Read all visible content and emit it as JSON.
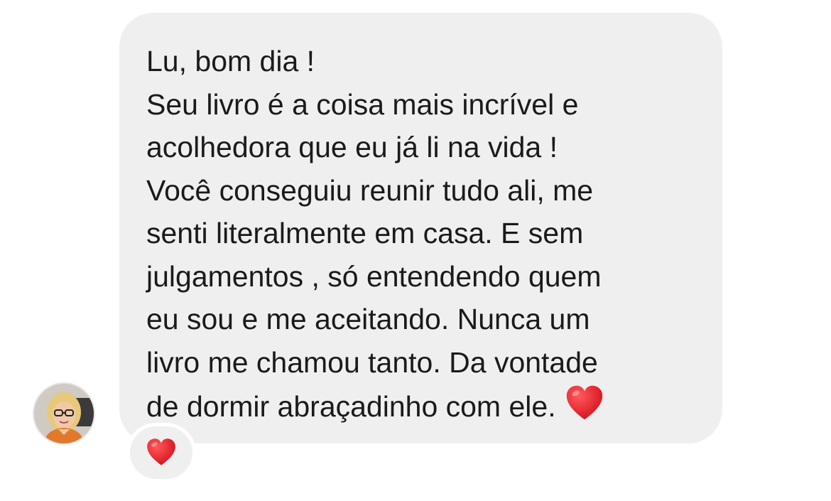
{
  "message": {
    "lines": [
      "Lu, bom dia !",
      "Seu livro é a coisa mais incrível e",
      "acolhedora que eu já li na vida !",
      "Você conseguiu reunir tudo ali, me",
      "senti literalmente em casa. E sem",
      "julgamentos , só entendendo quem",
      "eu sou e me aceitando. Nunca um",
      "livro me chamou tanto. Da vontade",
      "de dormir abraçadinho com ele."
    ],
    "inline_emoji": "red-heart",
    "bubble_color": "#efefef",
    "text_color": "#1a1a1a"
  },
  "reaction": {
    "emoji": "red-heart",
    "heart_color": "#e0202e"
  },
  "sender": {
    "avatar": "profile-photo"
  }
}
